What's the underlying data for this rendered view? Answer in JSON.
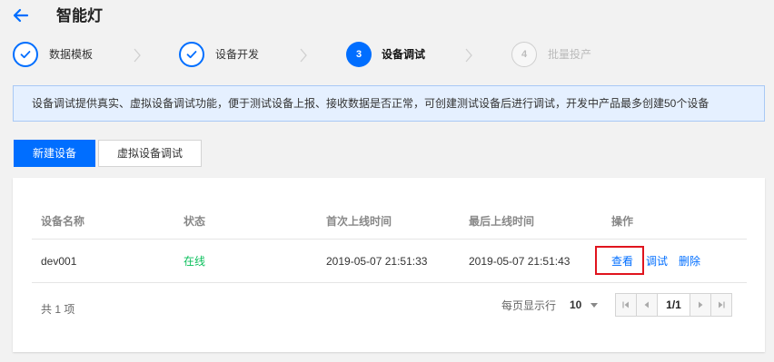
{
  "header": {
    "title": "智能灯"
  },
  "steps": [
    {
      "number": "",
      "label": "数据模板",
      "state": "done"
    },
    {
      "number": "",
      "label": "设备开发",
      "state": "done"
    },
    {
      "number": "3",
      "label": "设备调试",
      "state": "active"
    },
    {
      "number": "4",
      "label": "批量投产",
      "state": "pending"
    }
  ],
  "notice": {
    "text": "设备调试提供真实、虚拟设备调试功能，便于测试设备上报、接收数据是否正常，可创建测试设备后进行调试，开发中产品最多创建50个设备"
  },
  "toolbar": {
    "new_device_label": "新建设备",
    "virtual_debug_label": "虚拟设备调试"
  },
  "table": {
    "columns": [
      "设备名称",
      "状态",
      "首次上线时间",
      "最后上线时间",
      "操作"
    ],
    "rows": [
      {
        "name": "dev001",
        "status": "在线",
        "first_online": "2019-05-07 21:51:33",
        "last_online": "2019-05-07 21:51:43",
        "actions": [
          "查看",
          "调试",
          "删除"
        ]
      }
    ]
  },
  "footer": {
    "total_label": "共 1 项",
    "per_page_label": "每页显示行",
    "per_page_value": "10",
    "page_indicator": "1/1"
  },
  "colors": {
    "primary": "#006eff",
    "online": "#0abf5b",
    "highlight": "#e0141e"
  }
}
